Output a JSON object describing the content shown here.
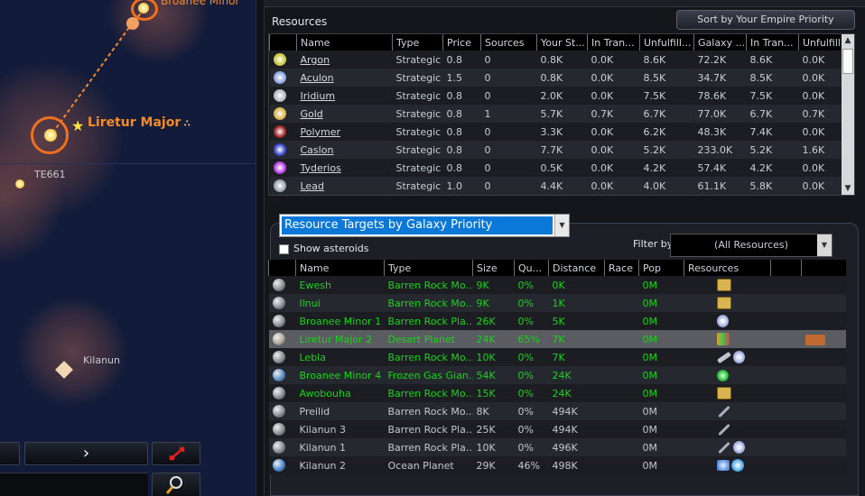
{
  "map": {
    "systems": [
      {
        "name": "Liretur Major",
        "color": "#f58a2a"
      },
      {
        "name": "TE661",
        "color": "#c9c9c9"
      },
      {
        "name": "Kilanun",
        "color": "#c9c9c9"
      }
    ],
    "partial_label": "Broanee Minor"
  },
  "resources_panel": {
    "title": "Resources",
    "sort_button": "Sort by Your Empire Priority",
    "columns": [
      "",
      "Name",
      "Type",
      "Price",
      "Sources",
      "Your St...",
      "In Tran...",
      "Unfulfill...",
      "Galaxy ...",
      "In Tran...",
      "Unfulfill"
    ],
    "rows": [
      {
        "icon": "argon-icon",
        "icon_color": "#c9c840",
        "name": "Argon",
        "type": "Strategic",
        "price": "0.8",
        "sources": "0",
        "your_stock": "0.8K",
        "in_transit": "0.0K",
        "unfulfilled": "8.6K",
        "galaxy": "72.2K",
        "g_in_transit": "8.6K",
        "g_unfulfilled": "0.0K"
      },
      {
        "icon": "aculon-icon",
        "icon_color": "#8ea4e0",
        "name": "Aculon",
        "type": "Strategic",
        "price": "1.5",
        "sources": "0",
        "your_stock": "0.8K",
        "in_transit": "0.0K",
        "unfulfilled": "8.5K",
        "galaxy": "34.7K",
        "g_in_transit": "8.5K",
        "g_unfulfilled": "0.0K"
      },
      {
        "icon": "iridium-icon",
        "icon_color": "#b8b8c0",
        "name": "Iridium",
        "type": "Strategic",
        "price": "0.8",
        "sources": "0",
        "your_stock": "2.0K",
        "in_transit": "0.0K",
        "unfulfilled": "7.5K",
        "galaxy": "78.6K",
        "g_in_transit": "7.5K",
        "g_unfulfilled": "0.0K"
      },
      {
        "icon": "gold-icon",
        "icon_color": "#d8b450",
        "name": "Gold",
        "type": "Strategic",
        "price": "0.8",
        "sources": "1",
        "your_stock": "5.7K",
        "in_transit": "0.7K",
        "unfulfilled": "6.7K",
        "galaxy": "77.0K",
        "g_in_transit": "6.7K",
        "g_unfulfilled": "0.7K"
      },
      {
        "icon": "polymer-icon",
        "icon_color": "#a02828",
        "name": "Polymer",
        "type": "Strategic",
        "price": "0.8",
        "sources": "0",
        "your_stock": "3.3K",
        "in_transit": "0.0K",
        "unfulfilled": "6.2K",
        "galaxy": "48.3K",
        "g_in_transit": "7.4K",
        "g_unfulfilled": "0.0K"
      },
      {
        "icon": "caslon-icon",
        "icon_color": "#3848c8",
        "name": "Caslon",
        "type": "Strategic",
        "price": "0.8",
        "sources": "0",
        "your_stock": "7.7K",
        "in_transit": "0.0K",
        "unfulfilled": "5.2K",
        "galaxy": "233.0K",
        "g_in_transit": "5.2K",
        "g_unfulfilled": "1.6K"
      },
      {
        "icon": "tyderios-icon",
        "icon_color": "#b040e0",
        "name": "Tyderios",
        "type": "Strategic",
        "price": "0.8",
        "sources": "0",
        "your_stock": "0.5K",
        "in_transit": "0.0K",
        "unfulfilled": "4.2K",
        "galaxy": "57.4K",
        "g_in_transit": "4.2K",
        "g_unfulfilled": "0.0K"
      },
      {
        "icon": "lead-icon",
        "icon_color": "#9aa4b0",
        "name": "Lead",
        "type": "Strategic",
        "price": "1.0",
        "sources": "0",
        "your_stock": "4.4K",
        "in_transit": "0.0K",
        "unfulfilled": "4.0K",
        "galaxy": "61.1K",
        "g_in_transit": "5.8K",
        "g_unfulfilled": "0.0K"
      }
    ]
  },
  "targets_panel": {
    "dropdown_value": "Resource Targets by Galaxy Priority",
    "show_asteroids_label": "Show asteroids",
    "filter_label": "Filter by",
    "filter_value": "(All Resources)",
    "columns": [
      "",
      "Name",
      "Type",
      "Size",
      "Qu...",
      "Distance",
      "Race",
      "Pop",
      "Resources",
      "",
      ""
    ],
    "rows": [
      {
        "planet_color": "#8a8e94",
        "name": "Ewesh",
        "type": "Barren Rock Mo...",
        "size": "9K",
        "quality": "0%",
        "distance": "0K",
        "race": "",
        "pop": "0M",
        "resources": [
          "gold-icon"
        ],
        "style": "green"
      },
      {
        "planet_color": "#8a8e94",
        "name": "Ilnui",
        "type": "Barren Rock Mo...",
        "size": "9K",
        "quality": "0%",
        "distance": "1K",
        "race": "",
        "pop": "0M",
        "resources": [
          "gold-icon"
        ],
        "style": "green"
      },
      {
        "planet_color": "#8a8e94",
        "name": "Broanee Minor 1",
        "type": "Barren Rock Pla...",
        "size": "26K",
        "quality": "0%",
        "distance": "5K",
        "race": "",
        "pop": "0M",
        "resources": [
          "aculon-icon"
        ],
        "style": "green"
      },
      {
        "planet_color": "#b0a89a",
        "name": "Liretur Major 2",
        "type": "Desert Planet",
        "size": "24K",
        "quality": "65%",
        "distance": "7K",
        "race": "",
        "pop": "0M",
        "resources": [
          "spires-icon",
          "colony-icon"
        ],
        "style": "selected"
      },
      {
        "planet_color": "#8a8e94",
        "name": "Lebla",
        "type": "Barren Rock Mo...",
        "size": "10K",
        "quality": "0%",
        "distance": "7K",
        "race": "",
        "pop": "0M",
        "resources": [
          "iridium-icon",
          "aculon-icon"
        ],
        "style": "green"
      },
      {
        "planet_color": "#5a8ec8",
        "name": "Broanee Minor 4",
        "type": "Frozen Gas Gian...",
        "size": "54K",
        "quality": "0%",
        "distance": "24K",
        "race": "",
        "pop": "0M",
        "resources": [
          "green-orb-icon"
        ],
        "style": "green"
      },
      {
        "planet_color": "#8a8e94",
        "name": "Awobouha",
        "type": "Barren Rock Mo...",
        "size": "15K",
        "quality": "0%",
        "distance": "24K",
        "race": "",
        "pop": "0M",
        "resources": [
          "gold-icon"
        ],
        "style": "green"
      },
      {
        "planet_color": "#8a8e94",
        "name": "Preilid",
        "type": "Barren Rock Mo...",
        "size": "8K",
        "quality": "0%",
        "distance": "494K",
        "race": "",
        "pop": "0M",
        "resources": [
          "lead-icon"
        ],
        "style": "grey"
      },
      {
        "planet_color": "#8a8e94",
        "name": "Kilanun 3",
        "type": "Barren Rock Pla...",
        "size": "25K",
        "quality": "0%",
        "distance": "494K",
        "race": "",
        "pop": "0M",
        "resources": [
          "lead-icon"
        ],
        "style": "grey"
      },
      {
        "planet_color": "#8a8e94",
        "name": "Kilanun 1",
        "type": "Barren Rock Pla...",
        "size": "10K",
        "quality": "0%",
        "distance": "496K",
        "race": "",
        "pop": "0M",
        "resources": [
          "lead-icon",
          "aculon-icon"
        ],
        "style": "grey"
      },
      {
        "planet_color": "#4a8ad0",
        "name": "Kilanun 2",
        "type": "Ocean Planet",
        "size": "29K",
        "quality": "46%",
        "distance": "498K",
        "race": "",
        "pop": "0M",
        "resources": [
          "crystals-icon",
          "blue-orb-icon"
        ],
        "style": "grey"
      }
    ]
  }
}
